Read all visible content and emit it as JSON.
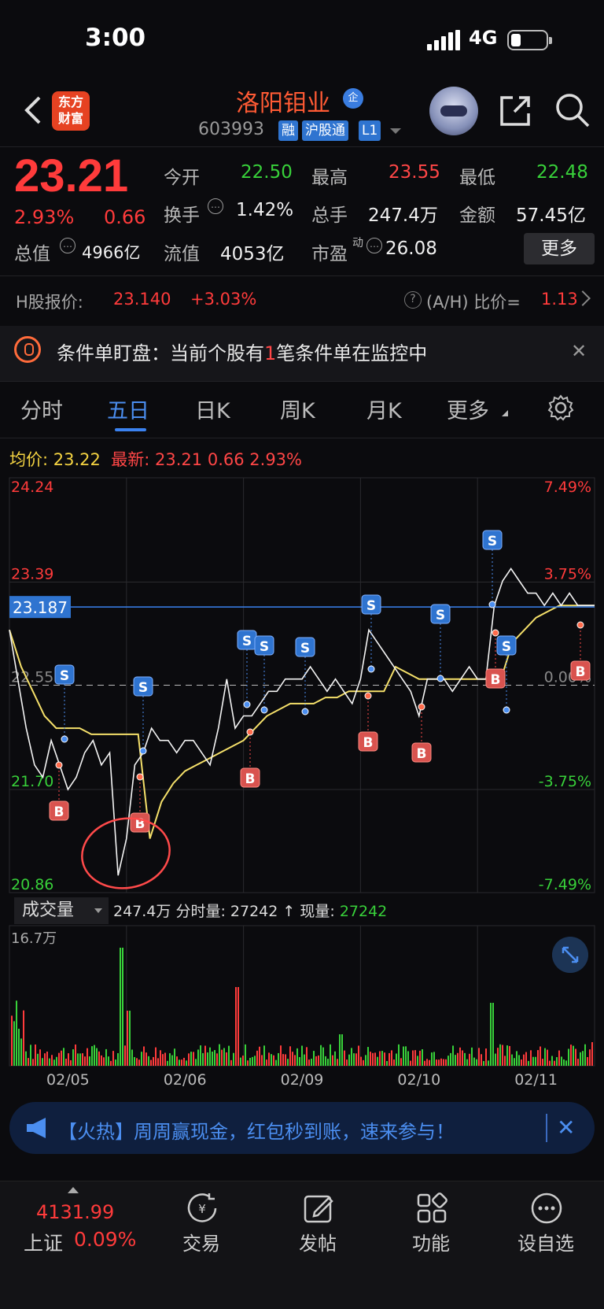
{
  "status_bar": {
    "time": "3:00",
    "network": "4G"
  },
  "header": {
    "logo_line1": "东方",
    "logo_line2": "财富",
    "stock_name": "洛阳钼业",
    "badge": "企",
    "stock_code": "603993",
    "tags": [
      "融",
      "沪股通",
      "L1"
    ]
  },
  "quote": {
    "price": "23.21",
    "change_pct": "2.93%",
    "change": "0.66",
    "open_label": "今开",
    "open": "22.50",
    "high_label": "最高",
    "high": "23.55",
    "low_label": "最低",
    "low": "22.48",
    "turnover_label": "换手",
    "turnover": "1.42%",
    "volume_label": "总手",
    "volume": "247.4万",
    "amount_label": "金额",
    "amount": "57.45亿",
    "mktcap_label": "总值",
    "mktcap": "4966亿",
    "float_label": "流值",
    "float_cap": "4053亿",
    "pe_label": "市盈",
    "pe_sup": "动",
    "pe": "26.08",
    "more": "更多"
  },
  "h_share": {
    "label": "H股报价:",
    "price": "23.140",
    "pct": "+3.03%",
    "ratio_label": "(A/H) 比价=",
    "ratio": "1.13"
  },
  "condition_banner": {
    "text_before": "条件单盯盘：当前个股有",
    "count": "1",
    "text_after": "笔条件单在监控中"
  },
  "tabs": [
    "分时",
    "五日",
    "日K",
    "周K",
    "月K",
    "更多"
  ],
  "active_tab": "五日",
  "avg_row": {
    "avg_label": "均价:",
    "avg": "23.22",
    "latest_label": "最新:",
    "latest": "23.21",
    "chg": "0.66",
    "pct": "2.93%"
  },
  "chart_data": {
    "type": "line",
    "title": "",
    "y_left_ticks": [
      "24.24",
      "23.39",
      "22.55",
      "21.70",
      "20.86"
    ],
    "y_right_ticks": [
      "7.49%",
      "3.75%",
      "0.00%",
      "-3.75%",
      "-7.49%"
    ],
    "ylim": [
      20.86,
      24.24
    ],
    "prev_close": 22.55,
    "crosshair_value": "23.187",
    "x_labels": [
      "02/05",
      "02/06",
      "02/09",
      "02/10",
      "02/11"
    ],
    "series": [
      {
        "name": "最新",
        "values": [
          23.0,
          22.6,
          22.2,
          21.9,
          21.8,
          22.1,
          21.9,
          21.7,
          21.8,
          22.0,
          22.1,
          21.9,
          22.0,
          21.0,
          21.3,
          21.9,
          22.0,
          22.2,
          22.1,
          22.1,
          22.0,
          22.1,
          22.1,
          22.0,
          21.9,
          22.2,
          22.6,
          22.2,
          22.3,
          22.3,
          22.4,
          22.5,
          22.5,
          22.6,
          22.6,
          22.6,
          22.7,
          22.6,
          22.5,
          22.6,
          22.5,
          22.4,
          22.6,
          23.0,
          22.9,
          22.8,
          22.7,
          22.6,
          22.5,
          22.3,
          22.6,
          22.6,
          22.6,
          22.5,
          22.6,
          22.7,
          22.6,
          22.6,
          23.2,
          23.4,
          23.5,
          23.4,
          23.3,
          23.3,
          23.2,
          23.3,
          23.2,
          23.3,
          23.2,
          23.2,
          23.2
        ]
      },
      {
        "name": "均价",
        "values": [
          23.0,
          22.7,
          22.5,
          22.3,
          22.2,
          22.2,
          22.2,
          22.15,
          22.15,
          22.15,
          22.15,
          22.15,
          21.3,
          21.6,
          21.75,
          21.85,
          21.9,
          21.95,
          22.0,
          22.05,
          22.1,
          22.2,
          22.3,
          22.35,
          22.4,
          22.4,
          22.4,
          22.45,
          22.45,
          22.5,
          22.5,
          22.5,
          22.5,
          22.7,
          22.65,
          22.6,
          22.6,
          22.6,
          22.6,
          22.6,
          22.6,
          22.6,
          22.6,
          22.9,
          23.0,
          23.1,
          23.15,
          23.2,
          23.2,
          23.2,
          23.2
        ]
      }
    ],
    "trade_marks": {
      "buy": [
        "B",
        "B",
        "B",
        "B",
        "B",
        "B",
        "B"
      ],
      "sell": [
        "S",
        "S",
        "S",
        "S",
        "S",
        "S",
        "S",
        "S",
        "S",
        "S"
      ]
    }
  },
  "volume": {
    "button": "成交量",
    "total": "247.4万",
    "fenshi_label": "分时量:",
    "fenshi": "27242",
    "arrow": "↑",
    "current_label": "现量:",
    "current": "27242",
    "max_label": "16.7万"
  },
  "promo": {
    "text": "【火热】周周赢现金，红包秒到账，速来参与！"
  },
  "bottom_nav": {
    "index_value": "4131.99",
    "index_name": "上证",
    "index_pct": "0.09%",
    "items": [
      "交易",
      "发帖",
      "功能",
      "设自选"
    ]
  },
  "colors": {
    "up": "#ff3b3b",
    "down": "#38d13a",
    "accent": "#3b82f0",
    "avg_line": "#f5e06a"
  }
}
